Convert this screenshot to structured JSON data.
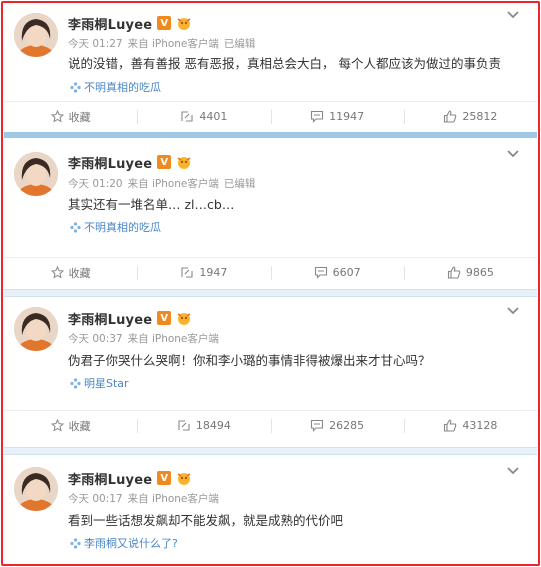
{
  "accent": "#e8262d",
  "link_color": "#4a87c6",
  "posts": [
    {
      "name": "李雨桐Luyee",
      "time": "今天 01:27",
      "source": "来自 iPhone客户端",
      "edited": "已编辑",
      "text": "说的没错，善有善报 恶有恶报，真相总会大白， 每个人都应该为做过的事负责",
      "topic": "不明真相的吃瓜",
      "actions": {
        "fav": "收藏",
        "repost": "4401",
        "comment": "11947",
        "like": "25812"
      }
    },
    {
      "name": "李雨桐Luyee",
      "time": "今天 01:20",
      "source": "来自 iPhone客户端",
      "edited": "已编辑",
      "text": "其实还有一堆名单… zl…cb…",
      "topic": "不明真相的吃瓜",
      "actions": {
        "fav": "收藏",
        "repost": "1947",
        "comment": "6607",
        "like": "9865"
      }
    },
    {
      "name": "李雨桐Luyee",
      "time": "今天 00:37",
      "source": "来自 iPhone客户端",
      "edited": "",
      "text": "伪君子你哭什么哭啊！你和李小璐的事情非得被爆出来才甘心吗？",
      "topic": "明星Star",
      "actions": {
        "fav": "收藏",
        "repost": "18494",
        "comment": "26285",
        "like": "43128"
      }
    },
    {
      "name": "李雨桐Luyee",
      "time": "今天 00:17",
      "source": "来自 iPhone客户端",
      "edited": "",
      "text": "看到一些话想发飙却不能发飙，就是成熟的代价吧",
      "topic": "李雨桐又说什么了?",
      "actions": {
        "fav": "",
        "repost": "",
        "comment": "",
        "like": ""
      }
    }
  ],
  "badges": {
    "verified": "V"
  },
  "icons": [
    "avatar",
    "verified-icon",
    "level-icon",
    "chevron-down-icon",
    "topic-icon",
    "star-icon",
    "repost-icon",
    "comment-icon",
    "like-icon"
  ]
}
